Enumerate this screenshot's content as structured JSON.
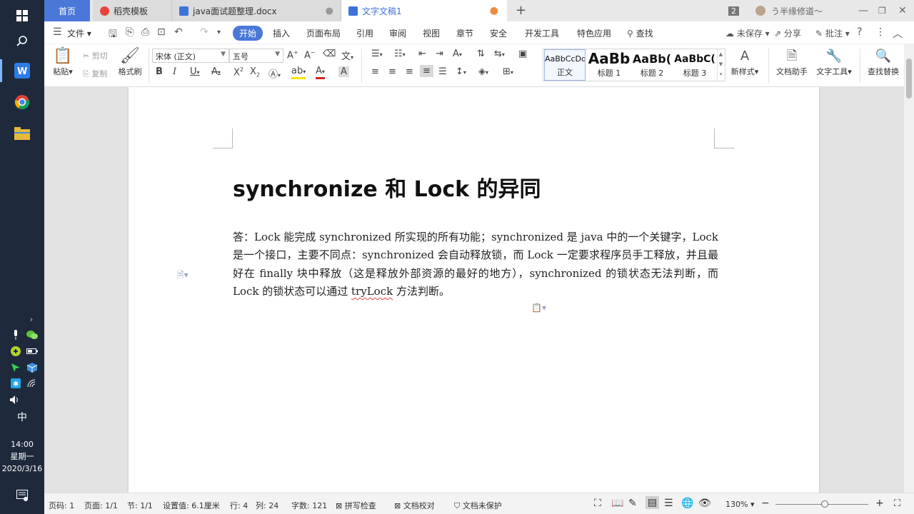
{
  "taskbar": {
    "clock_time": "14:00",
    "clock_day": "星期一",
    "clock_date": "2020/3/16",
    "ime": "中"
  },
  "titlebar": {
    "home_tab": "首页",
    "tabs": [
      {
        "label": "稻壳模板"
      },
      {
        "label": "java面试题整理.docx"
      },
      {
        "label": "文字文稿1"
      }
    ],
    "badge": "2",
    "user": "う半缘修道～"
  },
  "menu": {
    "file": "文件",
    "items": [
      "开始",
      "插入",
      "页面布局",
      "引用",
      "审阅",
      "视图",
      "章节",
      "安全",
      "开发工具",
      "特色应用"
    ],
    "search": "查找",
    "unsaved": "未保存",
    "share": "分享",
    "comment": "批注"
  },
  "ribbon": {
    "paste": "粘贴",
    "cut": "剪切",
    "copy": "复制",
    "format_painter": "格式刷",
    "font_name": "宋体 (正文)",
    "font_size": "五号",
    "styles": [
      {
        "preview": "AaBbCcDd",
        "name": "正文"
      },
      {
        "preview": "AaBb",
        "name": "标题 1"
      },
      {
        "preview": "AaBb(",
        "name": "标题 2"
      },
      {
        "preview": "AaBbC(",
        "name": "标题 3"
      }
    ],
    "new_style": "新样式",
    "doc_assistant": "文档助手",
    "text_tools": "文字工具",
    "find_replace": "查找替换"
  },
  "document": {
    "title": "synchronize 和 Lock 的异同",
    "body_before": "答：Lock  能完成 synchronized 所实现的所有功能；synchronized 是 java 中的一个关键字，Lock 是一个接口，主要不同点：synchronized 会自动释放锁，而 Lock 一定要求程序员手工释放，并且最好在 finally  块中释放（这是释放外部资源的最好的地方），synchronized 的锁状态无法判断，而 Lock 的锁状态可以通过 ",
    "body_misspelled": "tryLock",
    "body_after": " 方法判断。"
  },
  "statusbar": {
    "page_no": "页码: 1",
    "page": "页面: 1/1",
    "section": "节: 1/1",
    "setting": "设置值: 6.1厘米",
    "row": "行: 4",
    "col": "列: 24",
    "word_count": "字数: 121",
    "spellcheck": "拼写检查",
    "proofread": "文档校对",
    "protect": "文档未保护",
    "zoom": "130%"
  }
}
